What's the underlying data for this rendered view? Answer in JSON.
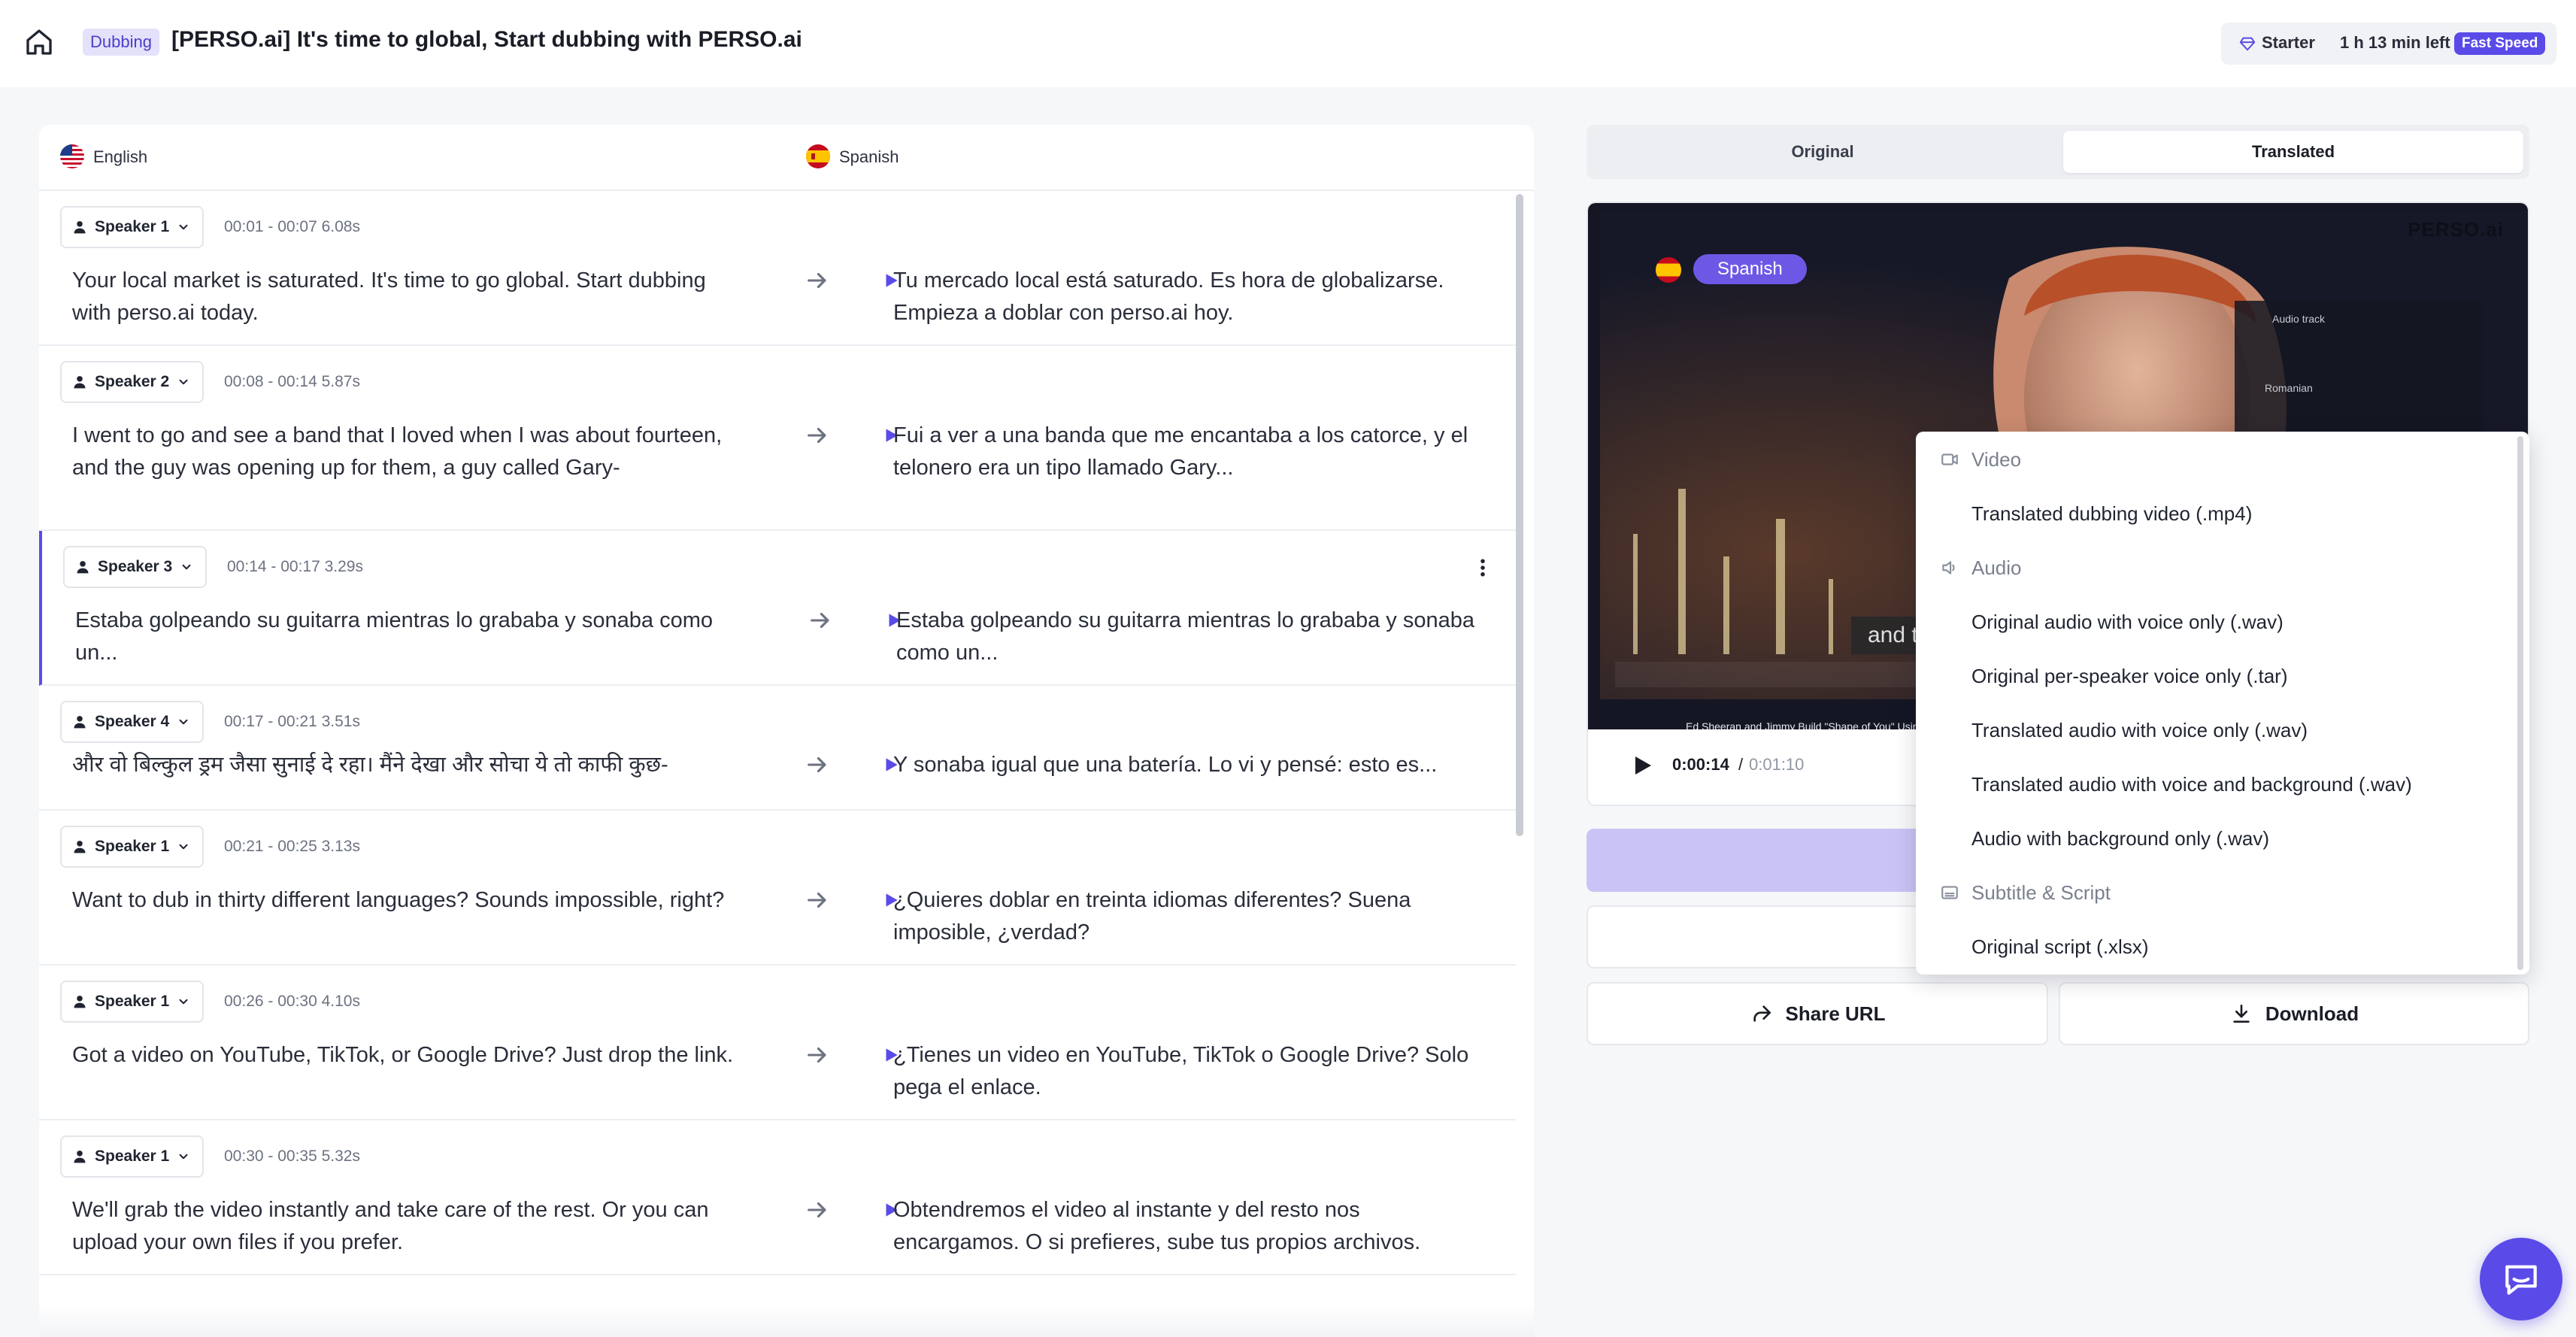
{
  "header": {
    "badge": "Dubbing",
    "title": "[PERSO.ai] It's time to global, Start dubbing with PERSO.ai",
    "plan": "Starter",
    "time_left": "1 h 13 min left",
    "speed": "Fast Speed"
  },
  "languages": {
    "source": "English",
    "target": "Spanish"
  },
  "segments": [
    {
      "speaker": "Speaker 1",
      "time": "00:01 - 00:07 6.08s",
      "source": "Your local market is saturated. It's time to go global. Start dubbing with perso.ai today.",
      "target": "Tu mercado local está saturado. Es hora de globalizarse. Empieza a doblar con perso.ai hoy."
    },
    {
      "speaker": "Speaker 2",
      "time": "00:08 - 00:14 5.87s",
      "source": "I went to go and see a band that I loved when I was about fourteen, and the guy was opening up for them, a guy called Gary-",
      "target": "Fui a ver a una banda que me encantaba a los catorce, y el telonero era un tipo llamado Gary..."
    },
    {
      "speaker": "Speaker 3",
      "time": "00:14 - 00:17 3.29s",
      "source": "Estaba golpeando su guitarra mientras lo grababa y sonaba como un...",
      "target": "Estaba golpeando su guitarra mientras lo grababa y sonaba como un..."
    },
    {
      "speaker": "Speaker 4",
      "time": "00:17 - 00:21 3.51s",
      "source": "और वो बिल्कुल ड्रम जैसा सुनाई दे रहा। मैंने देखा और सोचा ये तो काफी कुछ-",
      "target": "Y sonaba igual que una batería. Lo vi y pensé: esto es..."
    },
    {
      "speaker": "Speaker 1",
      "time": "00:21 - 00:25 3.13s",
      "source": "Want to dub in thirty different languages? Sounds impossible, right?",
      "target": "¿Quieres doblar en treinta idiomas diferentes? Suena imposible, ¿verdad?"
    },
    {
      "speaker": "Speaker 1",
      "time": "00:26 - 00:30 4.10s",
      "source": "Got a video on YouTube, TikTok, or Google Drive? Just drop the link.",
      "target": "¿Tienes un video en YouTube, TikTok o Google Drive? Solo pega el enlace."
    },
    {
      "speaker": "Speaker 1",
      "time": "00:30 - 00:35 5.32s",
      "source": "We'll grab the video instantly and take care of the rest. Or you can upload your own files if you prefer.",
      "target": "Obtendremos el video al instante y del resto nos encargamos. O si prefieres, sube tus propios archivos."
    }
  ],
  "view_toggle": {
    "original": "Original",
    "translated": "Translated"
  },
  "video": {
    "language_pill": "Spanish",
    "watermark": "PERSO.ai",
    "caption": "Ed Sheeran and Jimmy Build \"Shape of You\" Using a Loop",
    "subtitle": "and t",
    "panel_title": "Audio track",
    "panel_row": "Romanian",
    "current_time": "0:00:14",
    "separator": "/",
    "total_time": "0:01:10"
  },
  "actions": {
    "share": "Share URL",
    "download": "Download"
  },
  "download_menu": {
    "groups": [
      {
        "label": "Video",
        "icon": "video-icon",
        "items": [
          "Translated dubbing video (.mp4)"
        ]
      },
      {
        "label": "Audio",
        "icon": "speaker-icon",
        "items": [
          "Original audio with voice only (.wav)",
          "Original per-speaker voice only (.tar)",
          "Translated audio with voice only (.wav)",
          "Translated audio with voice and background (.wav)",
          "Audio with background only (.wav)"
        ]
      },
      {
        "label": "Subtitle & Script",
        "icon": "subtitle-icon",
        "items": [
          "Original script (.xlsx)"
        ]
      }
    ]
  },
  "colors": {
    "accent": "#5a4be8",
    "accent_light": "#c9c4f5",
    "badge_bg": "#e4e1fb"
  }
}
